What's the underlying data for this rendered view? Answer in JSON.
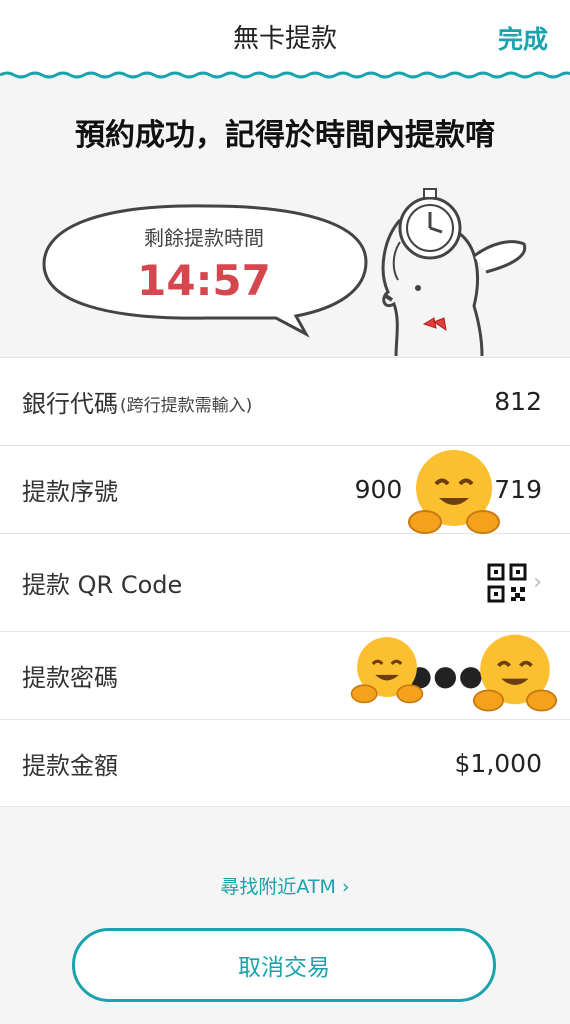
{
  "header": {
    "title": "無卡提款",
    "done_label": "完成"
  },
  "headline": "預約成功，記得於時間內提款唷",
  "timer": {
    "label": "剩餘提款時間",
    "value": "14:57"
  },
  "details": {
    "bank_code": {
      "label": "銀行代碼",
      "note": "(跨行提款需輸入)",
      "value": "812"
    },
    "withdrawal_serial": {
      "label": "提款序號",
      "value_start": "900",
      "value_end": "719"
    },
    "qr_code": {
      "label": "提款 QR Code",
      "icon": "qr-code-icon"
    },
    "password": {
      "label": "提款密碼",
      "value": "●●●"
    },
    "amount": {
      "label": "提款金額",
      "value": "$1,000"
    }
  },
  "atm_link": "尋找附近ATM ›",
  "cancel_label": "取消交易",
  "colors": {
    "accent": "#18a3ad",
    "timer": "#d4474f",
    "background": "#f5f5f5"
  }
}
